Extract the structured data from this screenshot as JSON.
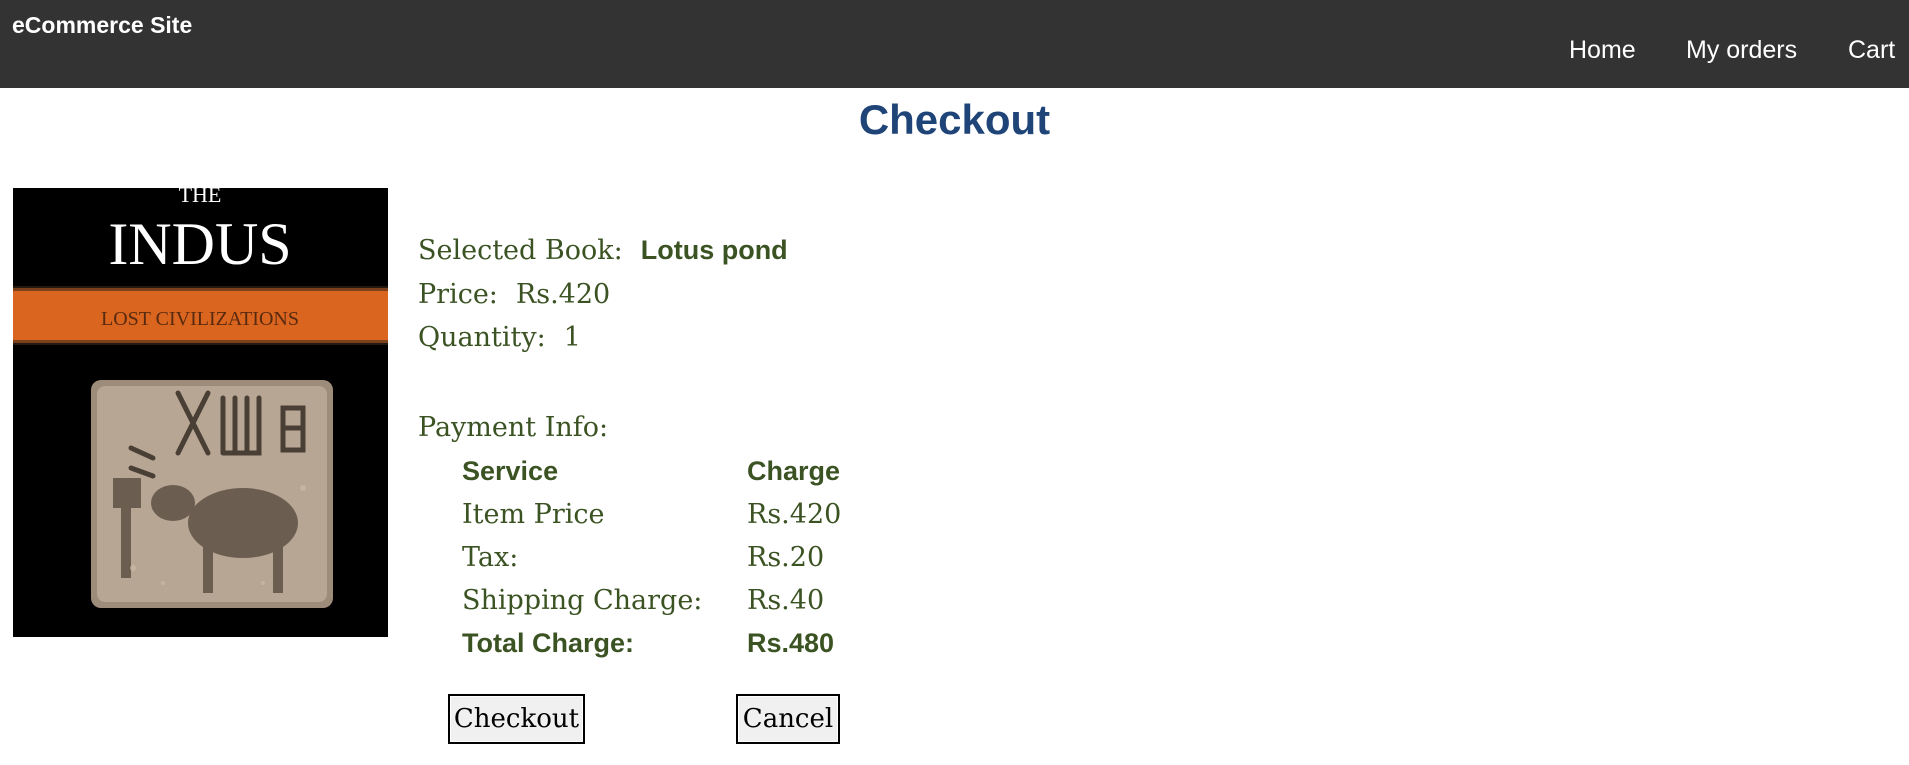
{
  "navbar": {
    "brand": "eCommerce Site",
    "links": [
      "Home",
      "My orders",
      "Cart"
    ]
  },
  "page": {
    "title": "Checkout"
  },
  "book": {
    "cover": {
      "top_text": "THE",
      "title_text": "INDUS",
      "band_text": "LOST CIVILIZATIONS"
    },
    "selected_label": "Selected Book:",
    "selected_value": "Lotus pond",
    "price_label": "Price:",
    "price_value": "Rs.420",
    "quantity_label": "Quantity:",
    "quantity_value": "1"
  },
  "payment": {
    "label": "Payment Info:",
    "headers": [
      "Service",
      "Charge"
    ],
    "rows": [
      {
        "service": "Item Price",
        "charge": "Rs.420"
      },
      {
        "service": "Tax:",
        "charge": "Rs.20"
      },
      {
        "service": "Shipping Charge:",
        "charge": "Rs.40"
      }
    ],
    "total": {
      "service": "Total Charge:",
      "charge": "Rs.480"
    }
  },
  "actions": {
    "checkout_label": "Checkout",
    "cancel_label": "Cancel"
  },
  "colors": {
    "navbar_bg": "#333333",
    "title": "#1f4478",
    "text_green": "#3b5323",
    "cover_band": "#d9651e"
  }
}
